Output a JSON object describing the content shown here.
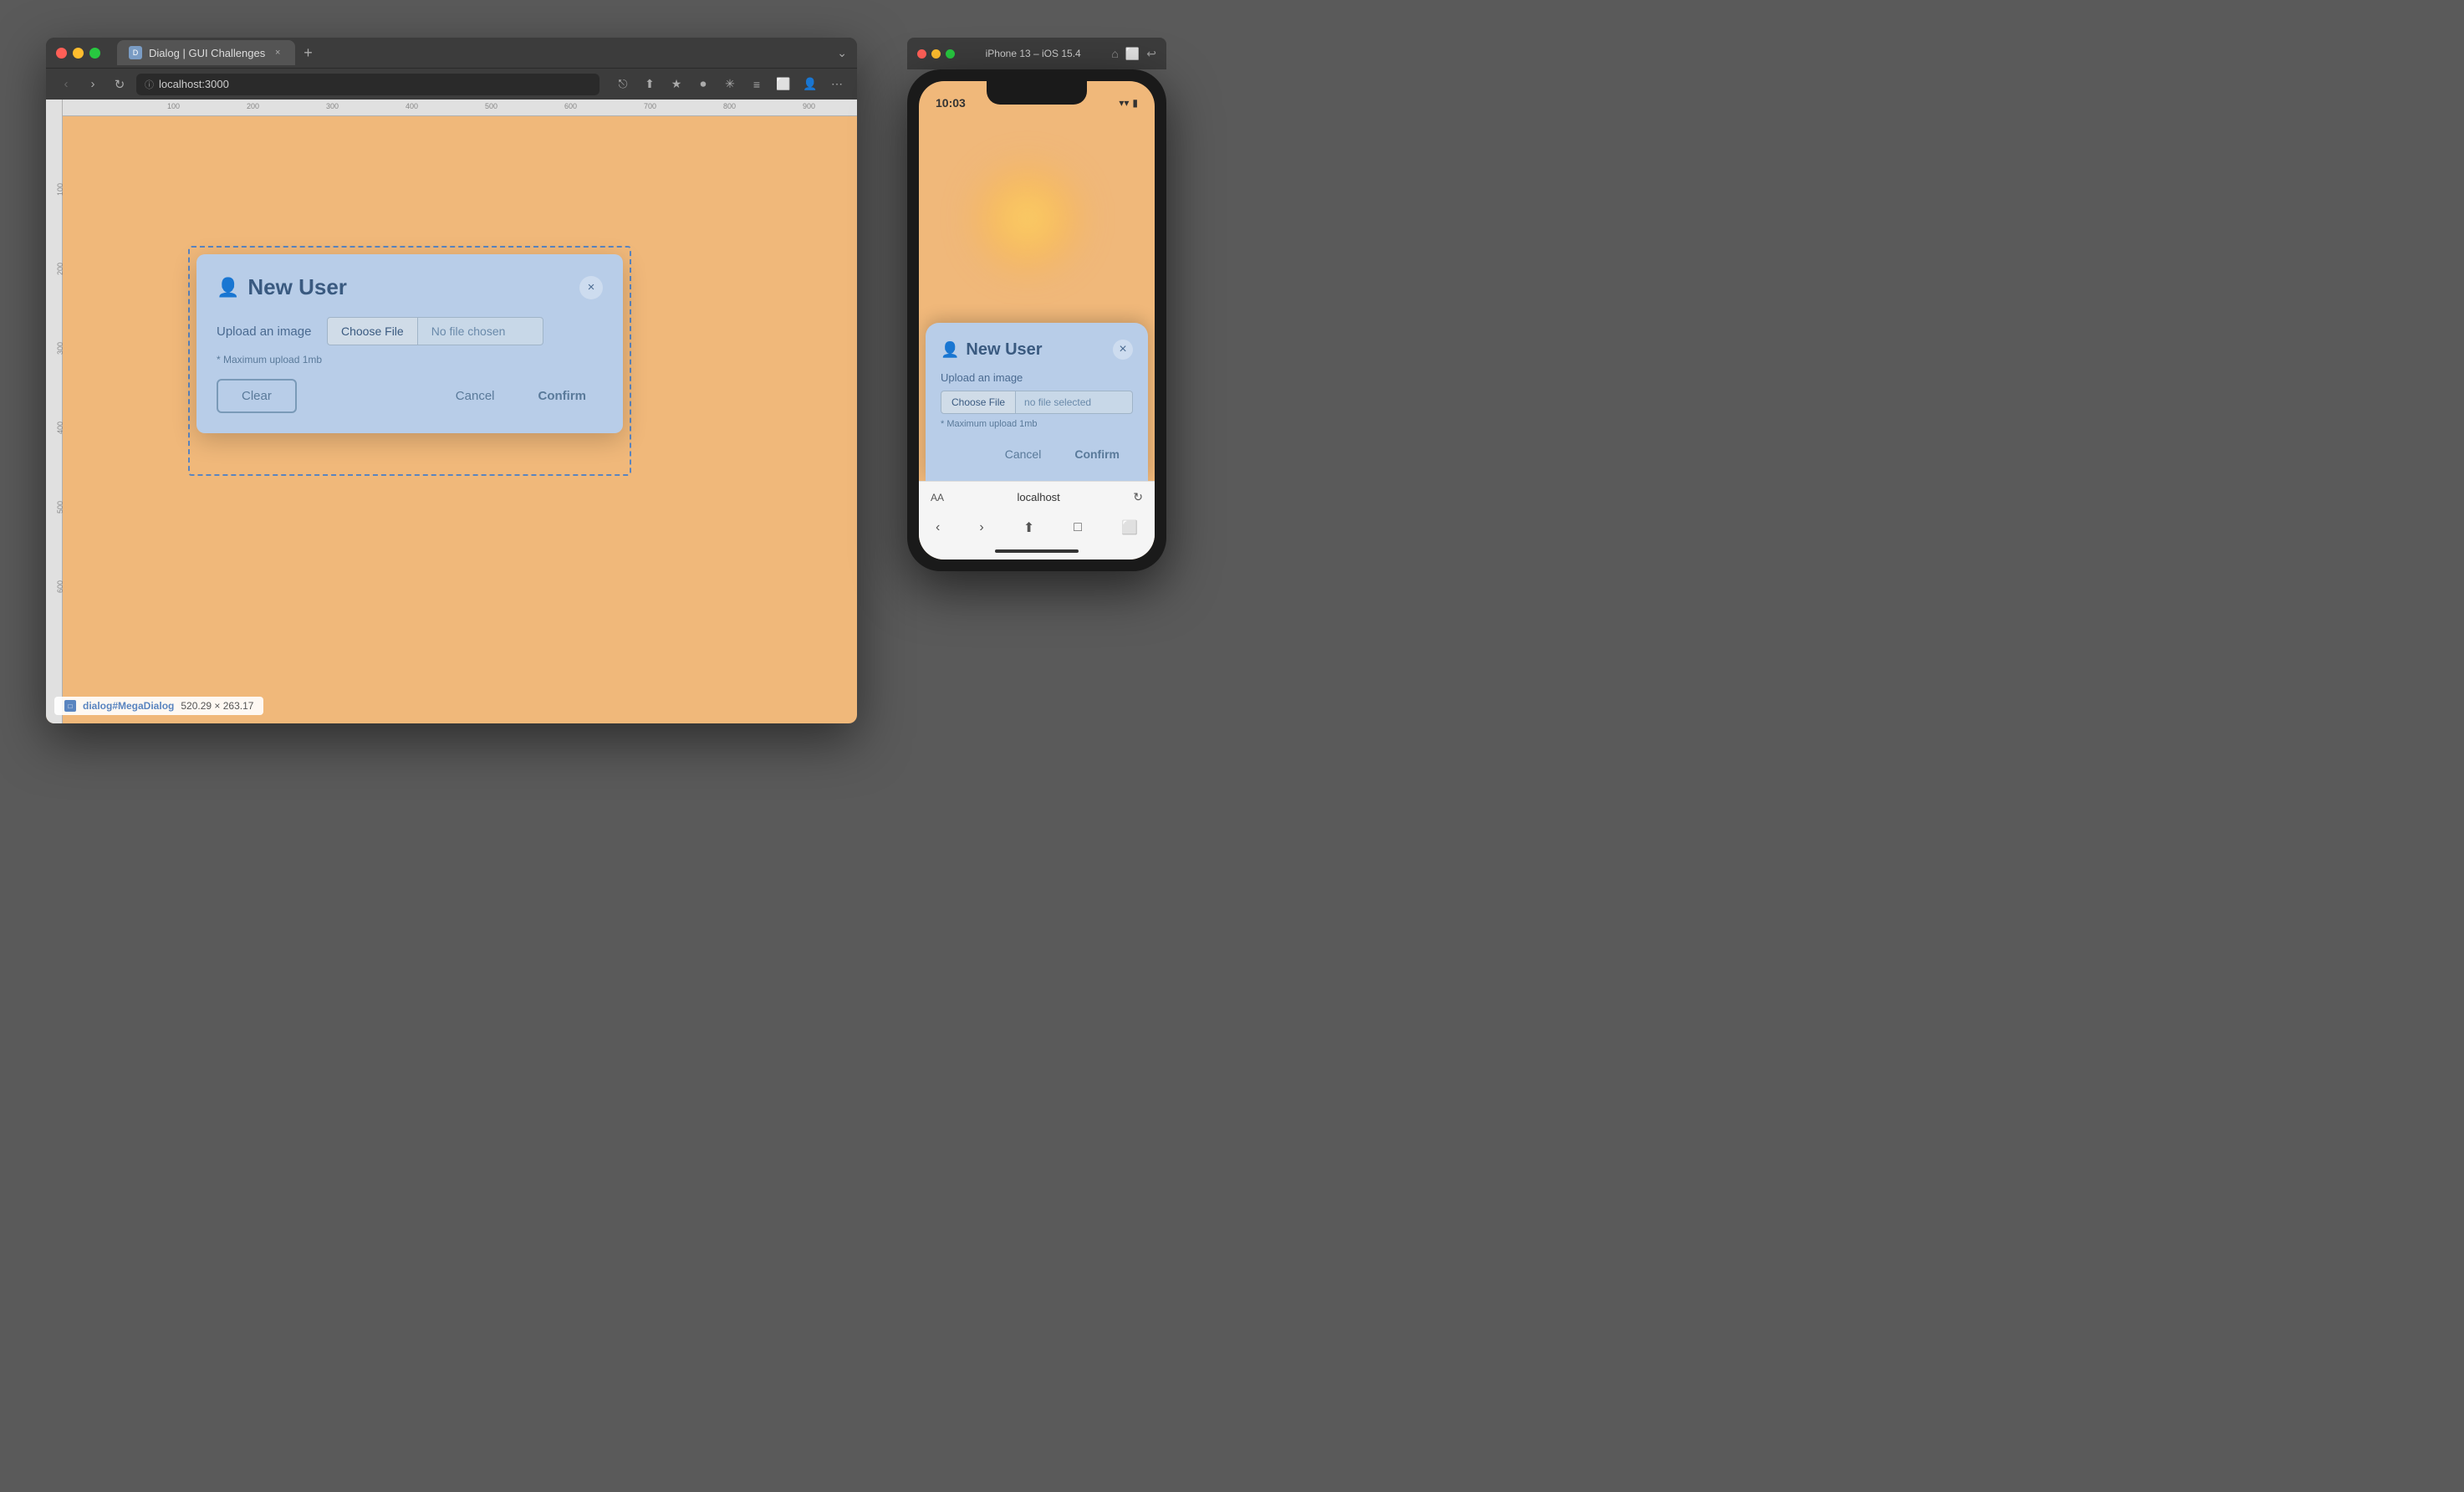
{
  "browser": {
    "tab_title": "Dialog | GUI Challenges",
    "tab_close": "×",
    "tab_add": "+",
    "window_controls": "⌄",
    "back_btn": "‹",
    "forward_btn": "›",
    "refresh_btn": "↻",
    "address": "localhost:3000",
    "toolbar_icons": [
      "⎋",
      "⬆",
      "★",
      "⏺",
      "✳",
      "≡",
      "⬜",
      "👤",
      "⋯"
    ],
    "page_background": "#f0b87a",
    "status_bar": {
      "icon_label": "□",
      "selector_text": "dialog#MegaDialog",
      "dimensions": "520.29 × 263.17"
    }
  },
  "desktop_dialog": {
    "title": "New User",
    "icon": "👤+",
    "close_btn": "×",
    "upload_label": "Upload an image",
    "choose_file_btn": "Choose File",
    "no_file_text": "No file chosen",
    "upload_hint": "* Maximum upload 1mb",
    "clear_btn": "Clear",
    "cancel_btn": "Cancel",
    "confirm_btn": "Confirm"
  },
  "phone": {
    "header_title": "iPhone 13 – iOS 15.4",
    "status_time": "10:03",
    "status_icons": "▾▾ 📶",
    "wifi_icon": "wifi",
    "battery_icon": "battery"
  },
  "mobile_dialog": {
    "title": "New User",
    "icon": "👤+",
    "close_btn": "×",
    "upload_label": "Upload an image",
    "choose_file_btn": "Choose File",
    "no_file_text": "no file selected",
    "upload_hint": "* Maximum upload 1mb",
    "cancel_btn": "Cancel",
    "confirm_btn": "Confirm"
  },
  "phone_bottom": {
    "aa_label": "AA",
    "url": "localhost",
    "reload_icon": "↻"
  }
}
